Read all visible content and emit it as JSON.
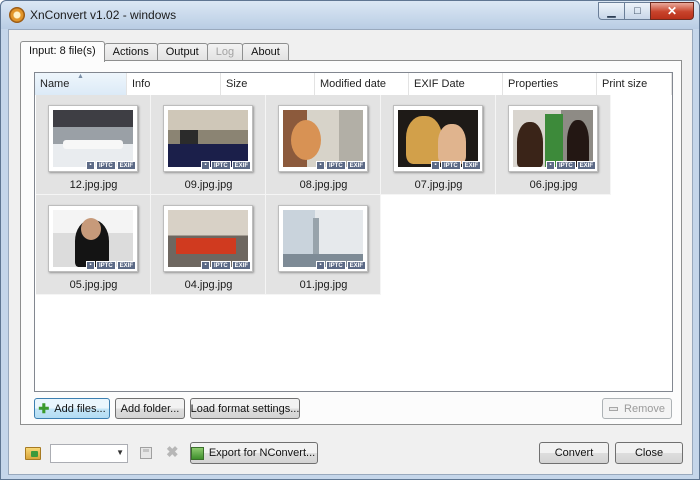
{
  "window": {
    "title": "XnConvert v1.02 - windows",
    "controls": {
      "minimize": "▁",
      "maximize": "□",
      "close": "✕"
    }
  },
  "tabs": [
    {
      "label": "Input: 8 file(s)",
      "state": "active"
    },
    {
      "label": "Actions",
      "state": "normal"
    },
    {
      "label": "Output",
      "state": "normal"
    },
    {
      "label": "Log",
      "state": "disabled"
    },
    {
      "label": "About",
      "state": "normal"
    }
  ],
  "list": {
    "columns": [
      "Name",
      "Info",
      "Size",
      "Modified date",
      "EXIF Date",
      "Properties",
      "Print size"
    ],
    "sorted_column": "Name",
    "sort_indicator": "▲",
    "badges": {
      "icon": "▪",
      "iptc": "IPTC",
      "exif": "EXIF"
    },
    "files": [
      "12.jpg.jpg",
      "09.jpg.jpg",
      "08.jpg.jpg",
      "07.jpg.jpg",
      "06.jpg.jpg",
      "05.jpg.jpg",
      "04.jpg.jpg",
      "01.jpg.jpg"
    ]
  },
  "buttons": {
    "add_files": "Add files...",
    "add_folder": "Add folder...",
    "load_format": "Load format settings...",
    "remove": "Remove",
    "export": "Export for NConvert...",
    "convert": "Convert",
    "close": "Close"
  },
  "bottom": {
    "combo_value": "",
    "combo_arrow": "▼",
    "delete_glyph": "✖"
  },
  "colors": {
    "accent": "#3c7fb1",
    "selection": "#e3e3e3",
    "badge": "#5c6a86"
  }
}
